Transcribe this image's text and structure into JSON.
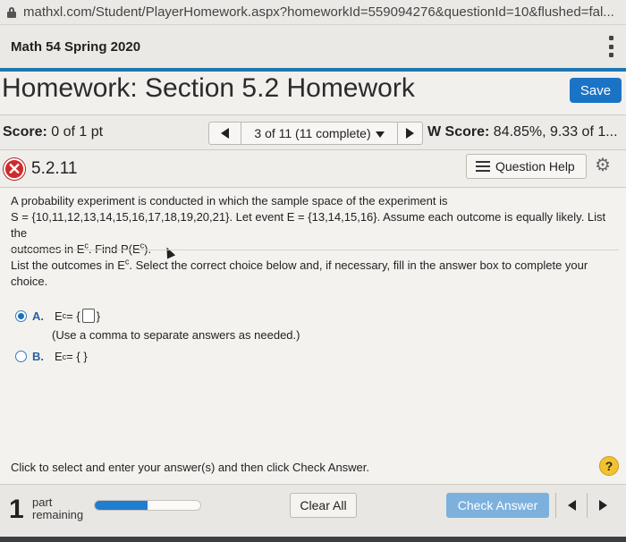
{
  "browser": {
    "url": "mathxl.com/Student/PlayerHomework.aspx?homeworkId=559094276&questionId=10&flushed=fal..."
  },
  "course": {
    "title": "Math 54 Spring 2020"
  },
  "homework": {
    "title": "Homework: Section 5.2 Homework",
    "save_label": "Save"
  },
  "score": {
    "label": "Score:",
    "value": "0 of 1 pt",
    "nav_label": "3 of 11 (11 complete)",
    "hw_label": "W Score:",
    "hw_value": "84.85%, 9.33 of 1..."
  },
  "question": {
    "id": "5.2.11",
    "help_label": "Question Help",
    "text_line1": "A probability experiment is conducted in which the sample space of the experiment is",
    "text_line2": "S = {10,11,12,13,14,15,16,17,18,19,20,21}. Let event E = {13,14,15,16}. Assume each outcome is equally likely. List the",
    "text_line3_a": "outcomes in E",
    "text_line3_sup": "c",
    "text_line3_b": ". Find P(E",
    "text_line3_sup2": "c",
    "text_line3_c": ").",
    "instruction_a": "List the outcomes in E",
    "instruction_sup": "c",
    "instruction_b": ". Select the correct choice below and, if necessary, fill in the answer box to complete your",
    "instruction_c": "choice.",
    "option_a_letter": "A.",
    "option_a_text": "E",
    "option_a_sup": "c",
    "option_a_eq": " = {",
    "option_a_close": "}",
    "option_a_hint": "(Use a comma to separate answers as needed.)",
    "option_b_letter": "B.",
    "option_b_text": "E",
    "option_b_sup": "c",
    "option_b_eq": " = { }",
    "footer_instruction": "Click to select and enter your answer(s) and then click Check Answer.",
    "help_icon": "?"
  },
  "bottom": {
    "part_num": "1",
    "part_label_1": "part",
    "part_label_2": "remaining",
    "progress_fraction": 0.5,
    "clear_label": "Clear All",
    "check_label": "Check Answer"
  },
  "colors": {
    "accent": "#1a73c5",
    "incorrect": "#d12a2a"
  }
}
